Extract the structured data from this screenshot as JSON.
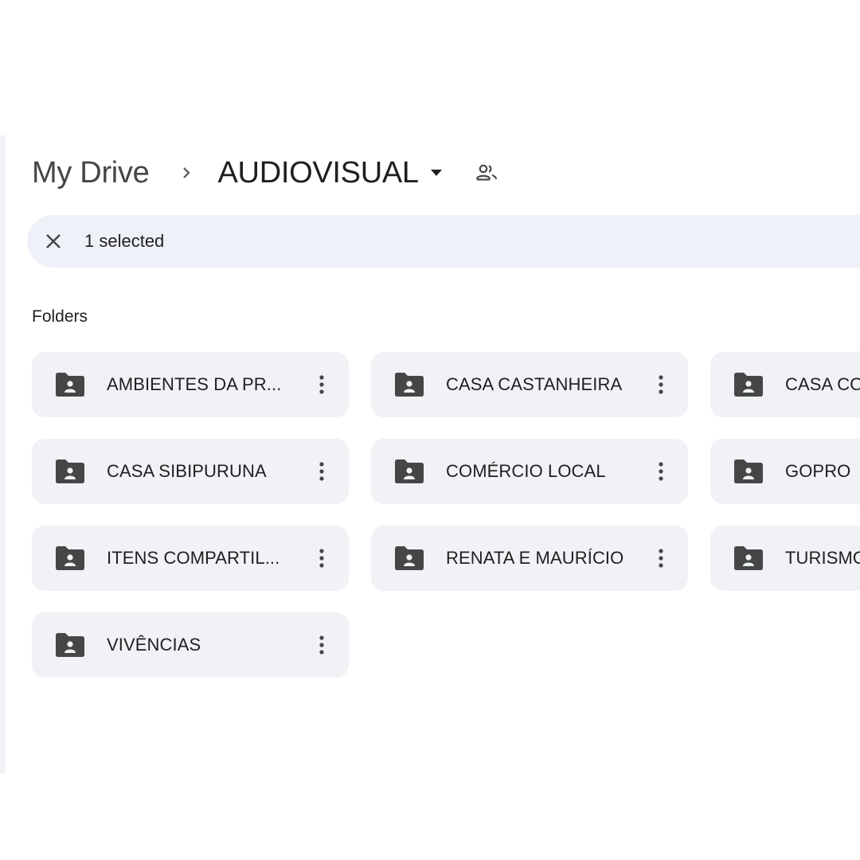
{
  "breadcrumb": {
    "root": "My Drive",
    "current": "AUDIOVISUAL"
  },
  "selection": {
    "count_label": "1 selected"
  },
  "section": {
    "title": "Folders"
  },
  "folders": [
    {
      "name": "AMBIENTES DA PR..."
    },
    {
      "name": "CASA CASTANHEIRA"
    },
    {
      "name": "CASA CO"
    },
    {
      "name": "CASA SIBIPURUNA"
    },
    {
      "name": "COMÉRCIO LOCAL"
    },
    {
      "name": "GOPRO"
    },
    {
      "name": "ITENS COMPARTIL..."
    },
    {
      "name": "RENATA E MAURÍCIO"
    },
    {
      "name": "TURISMO"
    },
    {
      "name": "VIVÊNCIAS"
    }
  ],
  "icons": {
    "folder": "shared-folder-icon",
    "more": "more-vert-icon",
    "close": "close-icon",
    "shared": "people-icon",
    "caret": "caret-down-icon",
    "separator": "chevron-right-icon"
  },
  "colors": {
    "card_bg": "#f0f2f6",
    "selection_bar_bg": "#eef1f7",
    "icon": "#444746",
    "text": "#1f1f1f"
  }
}
